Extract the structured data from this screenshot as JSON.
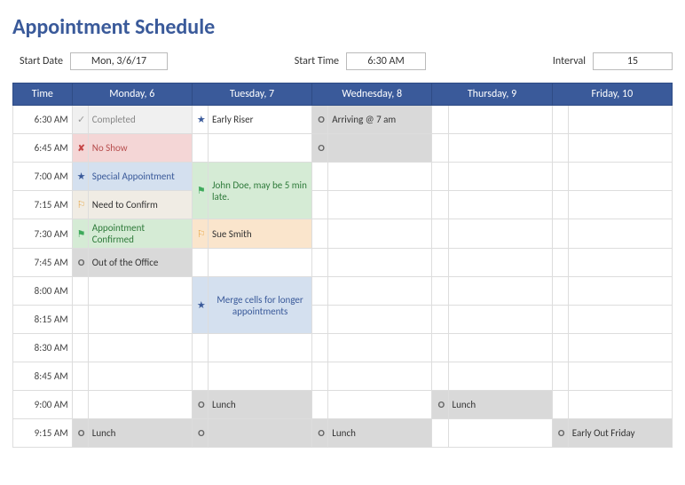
{
  "title": "Appointment Schedule",
  "controls": {
    "start_date_label": "Start Date",
    "start_date_value": "Mon, 3/6/17",
    "start_time_label": "Start Time",
    "start_time_value": "6:30 AM",
    "interval_label": "Interval",
    "interval_value": "15"
  },
  "headers": [
    "Time",
    "Monday, 6",
    "Tuesday, 7",
    "Wednesday, 8",
    "Thursday, 9",
    "Friday, 10"
  ],
  "times": [
    "6:30 AM",
    "6:45 AM",
    "7:00 AM",
    "7:15 AM",
    "7:30 AM",
    "7:45 AM",
    "8:00 AM",
    "8:15 AM",
    "8:30 AM",
    "8:45 AM",
    "9:00 AM",
    "9:15 AM"
  ],
  "cells": {
    "mon": {
      "r0": {
        "icon": "check",
        "text": "Completed"
      },
      "r1": {
        "icon": "x",
        "text": "No Show"
      },
      "r2": {
        "icon": "star",
        "text": "Special Appointment"
      },
      "r3": {
        "icon": "flag-o",
        "text": "Need to Confirm"
      },
      "r4": {
        "icon": "flag-g",
        "text": "Appointment Confirmed"
      },
      "r5": {
        "icon": "circle",
        "text": "Out of the Office"
      },
      "r11": {
        "icon": "circle",
        "text": "Lunch"
      }
    },
    "tue": {
      "r0": {
        "icon": "star",
        "text": "Early Riser"
      },
      "r2_3": {
        "icon": "flag-g",
        "text": "John Doe, may be 5 min late."
      },
      "r4": {
        "icon": "flag-o",
        "text": "Sue Smith"
      },
      "r6_7": {
        "icon": "star",
        "text": "Merge cells for longer appointments"
      },
      "r10": {
        "icon": "circle",
        "text": "Lunch"
      },
      "r11": {
        "icon": "circle",
        "text": ""
      }
    },
    "wed": {
      "r0": {
        "icon": "circle",
        "text": "Arriving @ 7 am"
      },
      "r1": {
        "icon": "circle",
        "text": ""
      },
      "r11": {
        "icon": "circle",
        "text": "Lunch"
      }
    },
    "thu": {
      "r10": {
        "icon": "circle",
        "text": "Lunch"
      }
    },
    "fri": {
      "r11": {
        "icon": "circle",
        "text": "Early Out Friday"
      }
    }
  }
}
